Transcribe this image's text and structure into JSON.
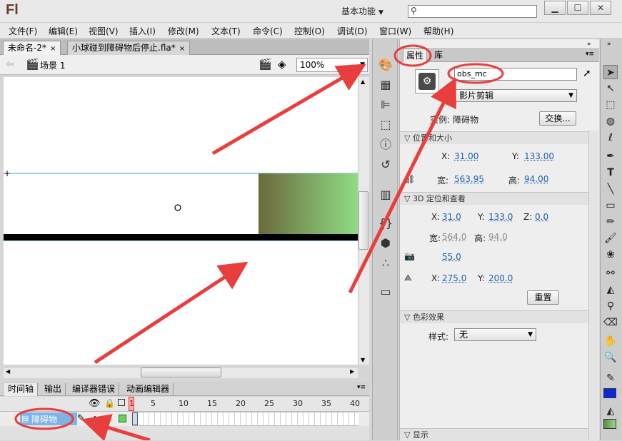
{
  "app": {
    "logo": "Fl",
    "workspace": "基本功能",
    "search_placeholder": ""
  },
  "menu": [
    "文件(F)",
    "编辑(E)",
    "视图(V)",
    "插入(I)",
    "修改(M)",
    "文本(T)",
    "命令(C)",
    "控制(O)",
    "调试(D)",
    "窗口(W)",
    "帮助(H)"
  ],
  "doc_tabs": [
    {
      "label": "未命名-2*",
      "close": "×"
    },
    {
      "label": "小球碰到障碍物后停止.fla*",
      "close": "×"
    }
  ],
  "editbar": {
    "scene": "场景 1",
    "zoom": "100%"
  },
  "timeline": {
    "tabs": [
      "时间轴",
      "输出",
      "编译器错误",
      "动画编辑器"
    ],
    "frame_numbers": [
      "1",
      "5",
      "10",
      "15",
      "20",
      "25",
      "30",
      "35",
      "40"
    ],
    "layer_name": "障碍物"
  },
  "props": {
    "tabs": [
      "属性",
      "库"
    ],
    "instance_name": "obs_mc",
    "symbol_type": "影片剪辑",
    "instance_label": "实例:",
    "instance_of": "障碍物",
    "swap_button": "交换...",
    "pos_section": "位置和大小",
    "x_label": "X:",
    "x": "31.00",
    "y_label": "Y:",
    "y": "133.00",
    "w_label": "宽:",
    "w": "563.95",
    "h_label": "高:",
    "h": "94.00",
    "d3_section": "3D 定位和查看",
    "x3": "31.0",
    "y3": "133.0",
    "z_label": "Z:",
    "z3": "0.0",
    "w3": "564.0",
    "h3": "94.0",
    "persp": "55.0",
    "vx": "275.0",
    "vy": "200.0",
    "reset_button": "重置",
    "color_section": "色彩效果",
    "style_label": "样式:",
    "style_value": "无",
    "display_section": "显示"
  },
  "colors": {
    "annotation": "#e83e3e",
    "gradient_start": "#6b6a3c",
    "gradient_end": "#8fdc84",
    "selection": "#7fb3e6"
  }
}
